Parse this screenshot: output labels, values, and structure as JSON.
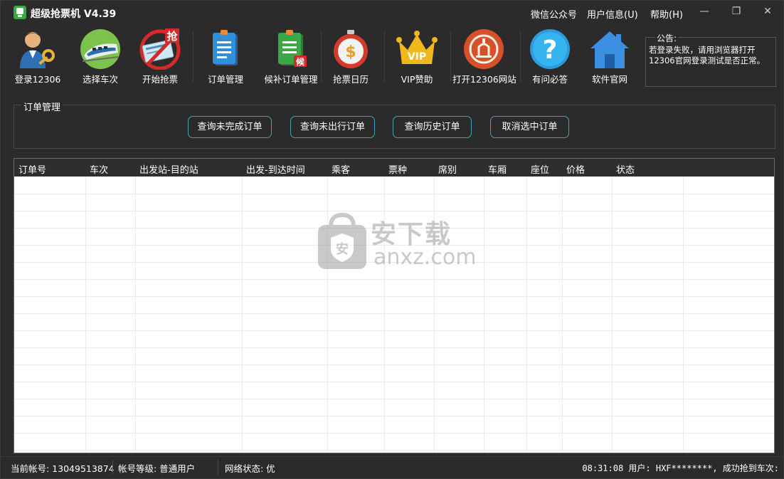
{
  "window": {
    "title": "超级抢票机 V4.39",
    "menu": [
      "微信公众号",
      "用户信息(U)",
      "帮助(H)"
    ],
    "controls": {
      "minimize": "—",
      "restore": "❐",
      "close": "✕"
    }
  },
  "toolbar": {
    "items": [
      {
        "label": "登录12306",
        "icon": "login-user-key-icon"
      },
      {
        "label": "选择车次",
        "icon": "train-icon"
      },
      {
        "label": "开始抢票",
        "icon": "ticket-grab-icon",
        "badge": "抢"
      },
      {
        "label": "订单管理",
        "icon": "order-document-icon"
      },
      {
        "label": "候补订单管理",
        "icon": "waitlist-document-icon",
        "badge": "候"
      },
      {
        "label": "抢票日历",
        "icon": "stopwatch-dollar-icon"
      },
      {
        "label": "VIP赞助",
        "icon": "vip-crown-icon",
        "badge": "VIP"
      },
      {
        "label": "打开12306网站",
        "icon": "railway-logo-icon"
      },
      {
        "label": "有问必答",
        "icon": "help-question-icon"
      },
      {
        "label": "软件官网",
        "icon": "home-icon"
      }
    ]
  },
  "notice": {
    "title": "公告:",
    "text": "若登录失败，请用浏览器打开12306官网登录测试是否正常。"
  },
  "orders": {
    "group_title": "订单管理",
    "buttons": [
      "查询未完成订单",
      "查询未出行订单",
      "查询历史订单",
      "取消选中订单"
    ],
    "columns": [
      "订单号",
      "车次",
      "出发站-目的站",
      "出发-到达时间",
      "乘客",
      "票种",
      "席别",
      "车厢",
      "座位",
      "价格",
      "状态"
    ],
    "rows": []
  },
  "watermark": {
    "main": "安下载",
    "sub": "anxz.com",
    "shield": "安"
  },
  "status": {
    "account": "当前帐号: 13049513874",
    "level": "帐号等级: 普通用户",
    "network": "网络状态: 优",
    "log": "08:31:08 用户: HXF********, 成功抢到车次:"
  },
  "colors": {
    "background": "#2b2b2b",
    "button_border": "#3fa3b8",
    "table_header": "#2e2e2e",
    "accent_green": "#3aa847"
  }
}
